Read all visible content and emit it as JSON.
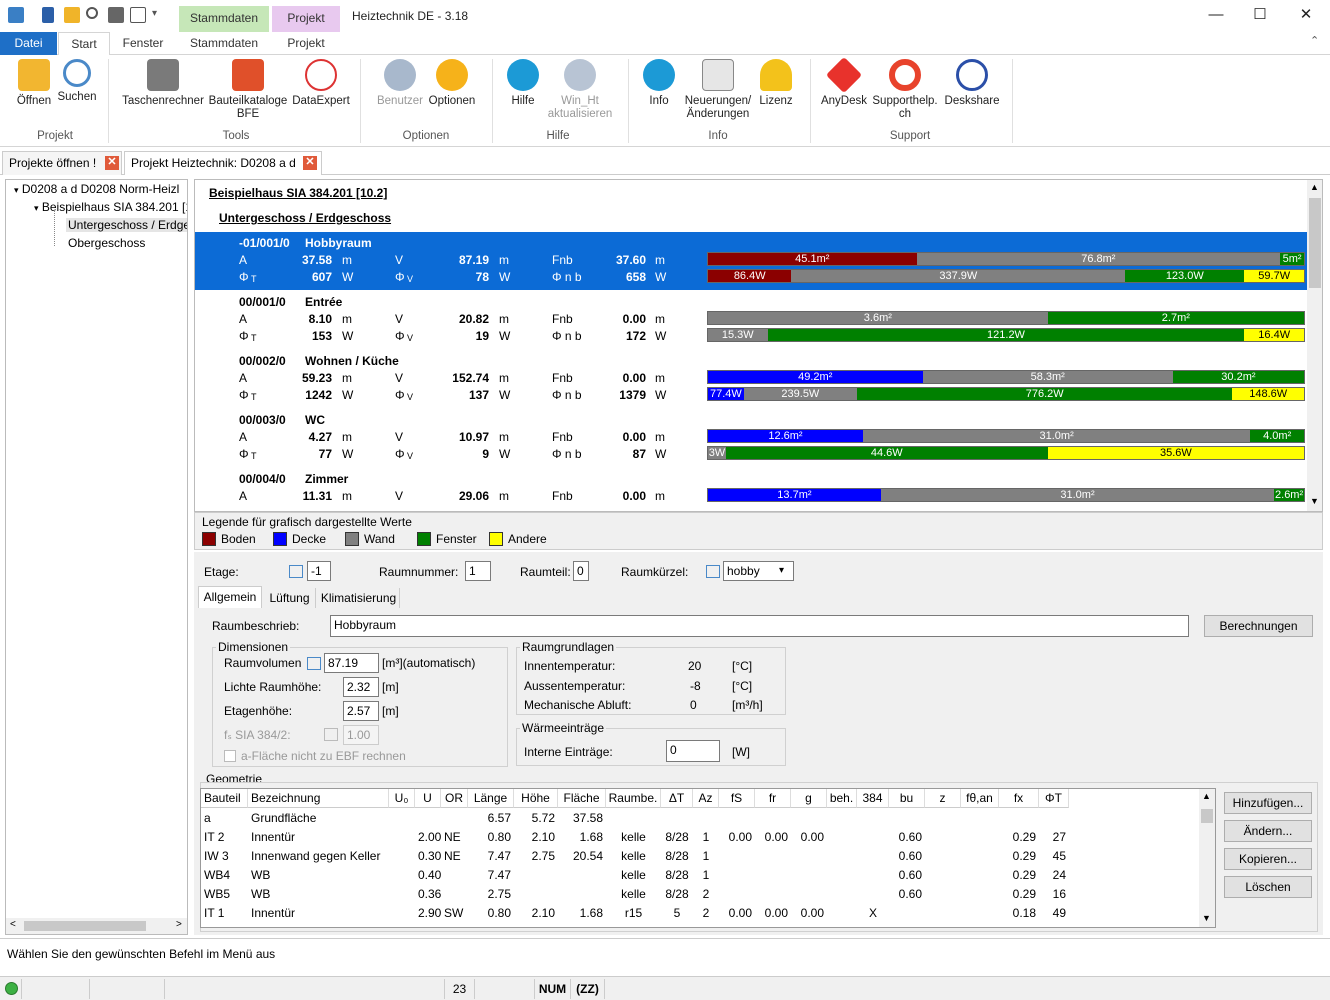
{
  "window": {
    "title": "Heiztechnik DE - 3.18",
    "context_tabs": [
      "Stammdaten",
      "Projekt"
    ]
  },
  "ribbon_tabs": [
    "Datei",
    "Start",
    "Fenster",
    "Stammdaten",
    "Projekt"
  ],
  "ribbon": {
    "groups": {
      "projekt": "Projekt",
      "tools": "Tools",
      "optionen": "Optionen",
      "hilfe": "Hilfe",
      "info": "Info",
      "support": "Support"
    },
    "buttons": {
      "oeffnen": "Öffnen",
      "suchen": "Suchen",
      "taschenrechner": "Taschenrechner",
      "bauteilkataloge": "Bauteilkataloge BFE",
      "dataexpert": "DataExpert",
      "benutzer": "Benutzer",
      "optionen": "Optionen",
      "hilfe": "Hilfe",
      "win_ht": "Win_Ht aktualisieren",
      "info": "Info",
      "neuerungen": "Neuerungen/ Änderungen",
      "lizenz": "Lizenz",
      "anydesk": "AnyDesk",
      "supporthelp": "Supporthelp. ch",
      "deskshare": "Deskshare"
    }
  },
  "doc_tabs": [
    "Projekte öffnen !",
    "Projekt Heiztechnik: D0208 a d"
  ],
  "tree": {
    "root": "D0208 a d   D0208 Norm-Heizl",
    "building": "Beispielhaus SIA 384.201 [1",
    "floor1": "Untergeschoss / Erdge",
    "floor2": "Obergeschoss"
  },
  "room_list": {
    "building": "Beispielhaus SIA 384.201 [10.2]",
    "floor": "Untergeschoss / Erdgeschoss",
    "labels": {
      "a": "A",
      "v": "V",
      "fnb": "Fnb",
      "phi_t": "Φ",
      "phi_t_sub": "T",
      "phi_v": "Φ",
      "phi_v_sub": "V",
      "phi_nb": "Φ n b",
      "m2": "m",
      "m3": "m",
      "w": "W"
    },
    "rooms": [
      {
        "id": "-01/001/0",
        "name": "Hobbyraum",
        "a": "37.58",
        "v": "87.19",
        "fnb": "37.60",
        "pt": "607",
        "pv": "78",
        "pnb": "658",
        "area_segments": [
          {
            "c": "#8b0000",
            "w": 35,
            "t": "45.1m²"
          },
          {
            "c": "#808080",
            "w": 61,
            "t": "76.8m²"
          },
          {
            "c": "#008000",
            "w": 4,
            "t": "5m²"
          }
        ],
        "heat_segments": [
          {
            "c": "#8b0000",
            "w": 14,
            "t": "86.4W"
          },
          {
            "c": "#808080",
            "w": 56,
            "t": "337.9W"
          },
          {
            "c": "#008000",
            "w": 20,
            "t": "123.0W"
          },
          {
            "c": "#ffff00",
            "w": 10,
            "t": "59.7W"
          }
        ]
      },
      {
        "id": "00/001/0",
        "name": "Entrée",
        "a": "8.10",
        "v": "20.82",
        "fnb": "0.00",
        "pt": "153",
        "pv": "19",
        "pnb": "172",
        "area_segments": [
          {
            "c": "#808080",
            "w": 57,
            "t": "3.6m²"
          },
          {
            "c": "#008000",
            "w": 43,
            "t": "2.7m²"
          }
        ],
        "heat_segments": [
          {
            "c": "#808080",
            "w": 10,
            "t": "15.3W"
          },
          {
            "c": "#008000",
            "w": 80,
            "t": "121.2W"
          },
          {
            "c": "#ffff00",
            "w": 10,
            "t": "16.4W"
          }
        ]
      },
      {
        "id": "00/002/0",
        "name": "Wohnen / Küche",
        "a": "59.23",
        "v": "152.74",
        "fnb": "0.00",
        "pt": "1242",
        "pv": "137",
        "pnb": "1379",
        "area_segments": [
          {
            "c": "#0000ff",
            "w": 36,
            "t": "49.2m²"
          },
          {
            "c": "#808080",
            "w": 42,
            "t": "58.3m²"
          },
          {
            "c": "#008000",
            "w": 22,
            "t": "30.2m²"
          }
        ],
        "heat_segments": [
          {
            "c": "#0000ff",
            "w": 6,
            "t": "77.4W"
          },
          {
            "c": "#808080",
            "w": 19,
            "t": "239.5W"
          },
          {
            "c": "#008000",
            "w": 63,
            "t": "776.2W"
          },
          {
            "c": "#ffff00",
            "w": 12,
            "t": "148.6W"
          }
        ]
      },
      {
        "id": "00/003/0",
        "name": "WC",
        "a": "4.27",
        "v": "10.97",
        "fnb": "0.00",
        "pt": "77",
        "pv": "9",
        "pnb": "87",
        "area_segments": [
          {
            "c": "#0000ff",
            "w": 26,
            "t": "12.6m²"
          },
          {
            "c": "#808080",
            "w": 65,
            "t": "31.0m²"
          },
          {
            "c": "#008000",
            "w": 9,
            "t": "4.0m²"
          }
        ],
        "heat_segments": [
          {
            "c": "#808080",
            "w": 3,
            "t": "3W"
          },
          {
            "c": "#008000",
            "w": 54,
            "t": "44.6W"
          },
          {
            "c": "#ffff00",
            "w": 43,
            "t": "35.6W"
          }
        ]
      },
      {
        "id": "00/004/0",
        "name": "Zimmer",
        "a": "11.31",
        "v": "29.06",
        "fnb": "0.00",
        "pt": "",
        "pv": "",
        "pnb": "",
        "area_segments": [
          {
            "c": "#0000ff",
            "w": 29,
            "t": "13.7m²"
          },
          {
            "c": "#808080",
            "w": 66,
            "t": "31.0m²"
          },
          {
            "c": "#008000",
            "w": 5,
            "t": "2.6m²"
          }
        ],
        "heat_segments": []
      }
    ]
  },
  "legend": {
    "title": "Legende für grafisch dargestellte Werte",
    "items": [
      {
        "label": "Boden",
        "color": "#8b0000"
      },
      {
        "label": "Decke",
        "color": "#0000ff"
      },
      {
        "label": "Wand",
        "color": "#808080"
      },
      {
        "label": "Fenster",
        "color": "#008000"
      },
      {
        "label": "Andere",
        "color": "#ffff00"
      }
    ]
  },
  "form": {
    "etage_label": "Etage:",
    "etage_value": "-1",
    "raumnummer_label": "Raumnummer:",
    "raumnummer_value": "1",
    "raumteil_label": "Raumteil:",
    "raumteil_value": "0",
    "raumkuerzel_label": "Raumkürzel:",
    "raumkuerzel_value": "hobby",
    "subtabs": [
      "Allgemein",
      "Lüftung",
      "Klimatisierung"
    ],
    "raumbeschrieb_label": "Raumbeschrieb:",
    "raumbeschrieb_value": "Hobbyraum",
    "berechnungen": "Berechnungen",
    "dimensionen": "Dimensionen",
    "raumvolumen_label": "Raumvolumen",
    "raumvolumen_value": "87.19",
    "raumvolumen_unit": "[m³](automatisch)",
    "lichte_label": "Lichte Raumhöhe:",
    "lichte_value": "2.32",
    "lichte_unit": "[m]",
    "etagenhoehe_label": "Etagenhöhe:",
    "etagenhoehe_value": "2.57",
    "etagenhoehe_unit": "[m]",
    "fs_label": "fₛ SIA 384/2:",
    "fs_value": "1.00",
    "aflaeche_label": "a-Fläche nicht zu EBF rechnen",
    "raumgrundlagen": "Raumgrundlagen",
    "innentemp_label": "Innentemperatur:",
    "innentemp_value": "20",
    "innentemp_unit": "[°C]",
    "aussentemp_label": "Aussentemperatur:",
    "aussentemp_value": "-8",
    "aussentemp_unit": "[°C]",
    "abluft_label": "Mechanische Abluft:",
    "abluft_value": "0",
    "abluft_unit": "[m³/h]",
    "waermeeintraege": "Wärmeeinträge",
    "interne_label": "Interne Einträge:",
    "interne_value": "0",
    "interne_unit": "[W]",
    "geometrie": "Geometrie"
  },
  "geometry": {
    "headers": [
      "Bauteil",
      "Bezeichnung",
      "U₀",
      "U",
      "OR",
      "Länge",
      "Höhe",
      "Fläche",
      "Raumbe.",
      "ΔT",
      "Az",
      "fS",
      "fr",
      "g",
      "beh.",
      "384",
      "bu",
      "z",
      "fθ,an",
      "fx",
      "ΦT"
    ],
    "rows": [
      [
        "a",
        "Grundfläche",
        "",
        "",
        "",
        "6.57",
        "5.72",
        "37.58",
        "",
        "",
        "",
        "",
        "",
        "",
        "",
        "",
        "",
        "",
        "",
        "",
        ""
      ],
      [
        "IT 2",
        "Innentür",
        "",
        "2.00",
        "NE",
        "0.80",
        "2.10",
        "1.68",
        "kelle",
        "8/28",
        "1",
        "0.00",
        "0.00",
        "0.00",
        "",
        "",
        "0.60",
        "",
        "",
        "0.29",
        "27"
      ],
      [
        "IW 3",
        "Innenwand gegen Keller",
        "",
        "0.30",
        "NE",
        "7.47",
        "2.75",
        "20.54",
        "kelle",
        "8/28",
        "1",
        "",
        "",
        "",
        "",
        "",
        "0.60",
        "",
        "",
        "0.29",
        "45"
      ],
      [
        "WB4",
        "WB",
        "",
        "0.40",
        "",
        "7.47",
        "",
        "",
        "kelle",
        "8/28",
        "1",
        "",
        "",
        "",
        "",
        "",
        "0.60",
        "",
        "",
        "0.29",
        "24"
      ],
      [
        "WB5",
        "WB",
        "",
        "0.36",
        "",
        "2.75",
        "",
        "",
        "kelle",
        "8/28",
        "2",
        "",
        "",
        "",
        "",
        "",
        "0.60",
        "",
        "",
        "0.29",
        "16"
      ],
      [
        "IT 1",
        "Innentür",
        "",
        "2.90",
        "SW",
        "0.80",
        "2.10",
        "1.68",
        "r15",
        "5",
        "2",
        "0.00",
        "0.00",
        "0.00",
        "",
        "X",
        "",
        "",
        "",
        "0.18",
        "49"
      ]
    ],
    "buttons": [
      "Hinzufügen...",
      "Ändern...",
      "Kopieren...",
      "Löschen"
    ]
  },
  "status": {
    "message": "Wählen Sie den gewünschten Befehl im Menü aus",
    "count": "23",
    "num": "NUM",
    "zz": "(ZZ)"
  }
}
